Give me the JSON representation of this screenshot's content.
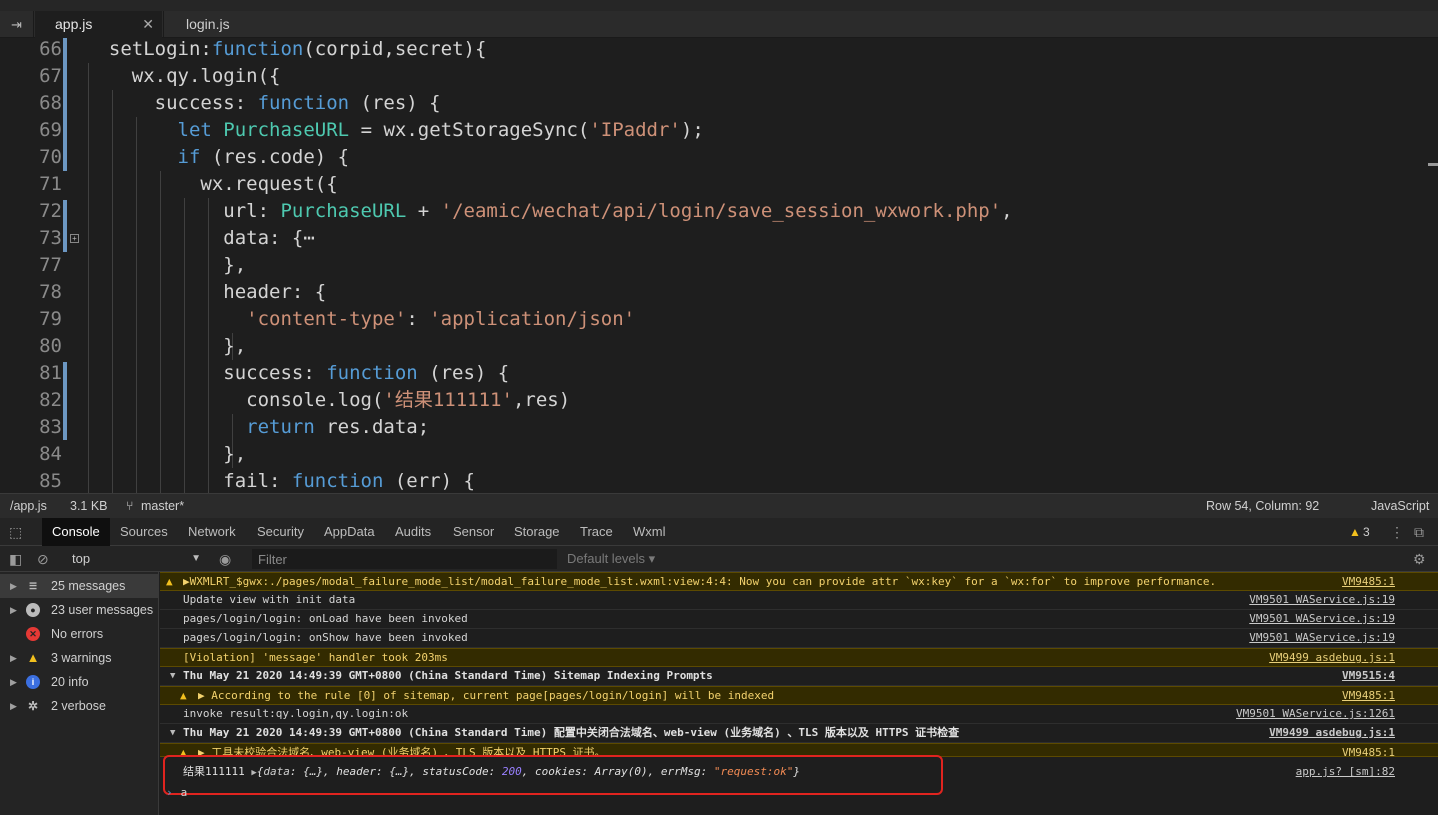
{
  "editor_tabs": [
    {
      "label": "app.js",
      "active": true
    },
    {
      "label": "login.js",
      "active": false
    }
  ],
  "line_numbers": [
    "66",
    "67",
    "68",
    "69",
    "70",
    "71",
    "72",
    "73",
    "77",
    "78",
    "79",
    "80",
    "81",
    "82",
    "83",
    "84",
    "85"
  ],
  "status": {
    "path": "/app.js",
    "size": "3.1 KB",
    "branch": "master*",
    "position": "Row 54, Column: 92",
    "language": "JavaScript"
  },
  "devtools_tabs": [
    "Console",
    "Sources",
    "Network",
    "Security",
    "AppData",
    "Audits",
    "Sensor",
    "Storage",
    "Trace",
    "Wxml"
  ],
  "warning_count": "3",
  "console_toolbar": {
    "context": "top",
    "filter_placeholder": "Filter",
    "levels": "Default levels"
  },
  "sidebar": [
    {
      "label": "25 messages",
      "icon": "list-icon"
    },
    {
      "label": "23 user messages",
      "icon": "user-icon"
    },
    {
      "label": "No errors",
      "icon": "error-icon"
    },
    {
      "label": "3 warnings",
      "icon": "warning-icon"
    },
    {
      "label": "20 info",
      "icon": "info-icon"
    },
    {
      "label": "2 verbose",
      "icon": "verbose-icon"
    }
  ],
  "messages": [
    {
      "type": "warn",
      "text": "▶WXMLRT_$gwx:./pages/modal_failure_mode_list/modal_failure_mode_list.wxml:view:4:4: Now you can provide attr `wx:key` for a `wx:for` to improve performance.",
      "source": "VM9485:1"
    },
    {
      "type": "log",
      "text": "Update view with init data",
      "source": "VM9501 WAService.js:19"
    },
    {
      "type": "log",
      "text": "pages/login/login: onLoad have been invoked",
      "source": "VM9501 WAService.js:19"
    },
    {
      "type": "log",
      "text": "pages/login/login: onShow have been invoked",
      "source": "VM9501 WAService.js:19"
    },
    {
      "type": "warn-plain",
      "text": "[Violation] 'message' handler took 203ms",
      "source": "VM9499 asdebug.js:1"
    },
    {
      "type": "group",
      "text": "Thu May 21 2020 14:49:39 GMT+0800 (China Standard Time) Sitemap Indexing Prompts",
      "source": "VM9515:4"
    },
    {
      "type": "warn",
      "text": "▶ According to the rule [0] of sitemap, current page[pages/login/login] will be indexed",
      "source": "VM9485:1"
    },
    {
      "type": "log",
      "text": "invoke result:qy.login,qy.login:ok",
      "source": "VM9501 WAService.js:1261"
    },
    {
      "type": "group",
      "text": "Thu May 21 2020 14:49:39 GMT+0800 (China Standard Time) 配置中关闭合法域名、web-view (业务域名) 、TLS 版本以及 HTTPS 证书检查",
      "source": "VM9499 asdebug.js:1"
    },
    {
      "type": "warn",
      "text": "▶ 工具未校验合法域名、web-view (业务域名) 、TLS 版本以及 HTTPS 证书。",
      "source": "VM9485:1"
    }
  ],
  "result": {
    "prefix": "结果111111",
    "k_data": "data",
    "v_data": "{…}",
    "k_header": "header",
    "v_header": "{…}",
    "k_status": "statusCode",
    "v_status": "200",
    "k_cookies": "cookies",
    "v_cookies": "Array(0)",
    "k_errmsg": "errMsg",
    "v_errmsg": "\"request:ok\"",
    "source": "app.js? [sm]:82"
  },
  "prompt_text": "a"
}
